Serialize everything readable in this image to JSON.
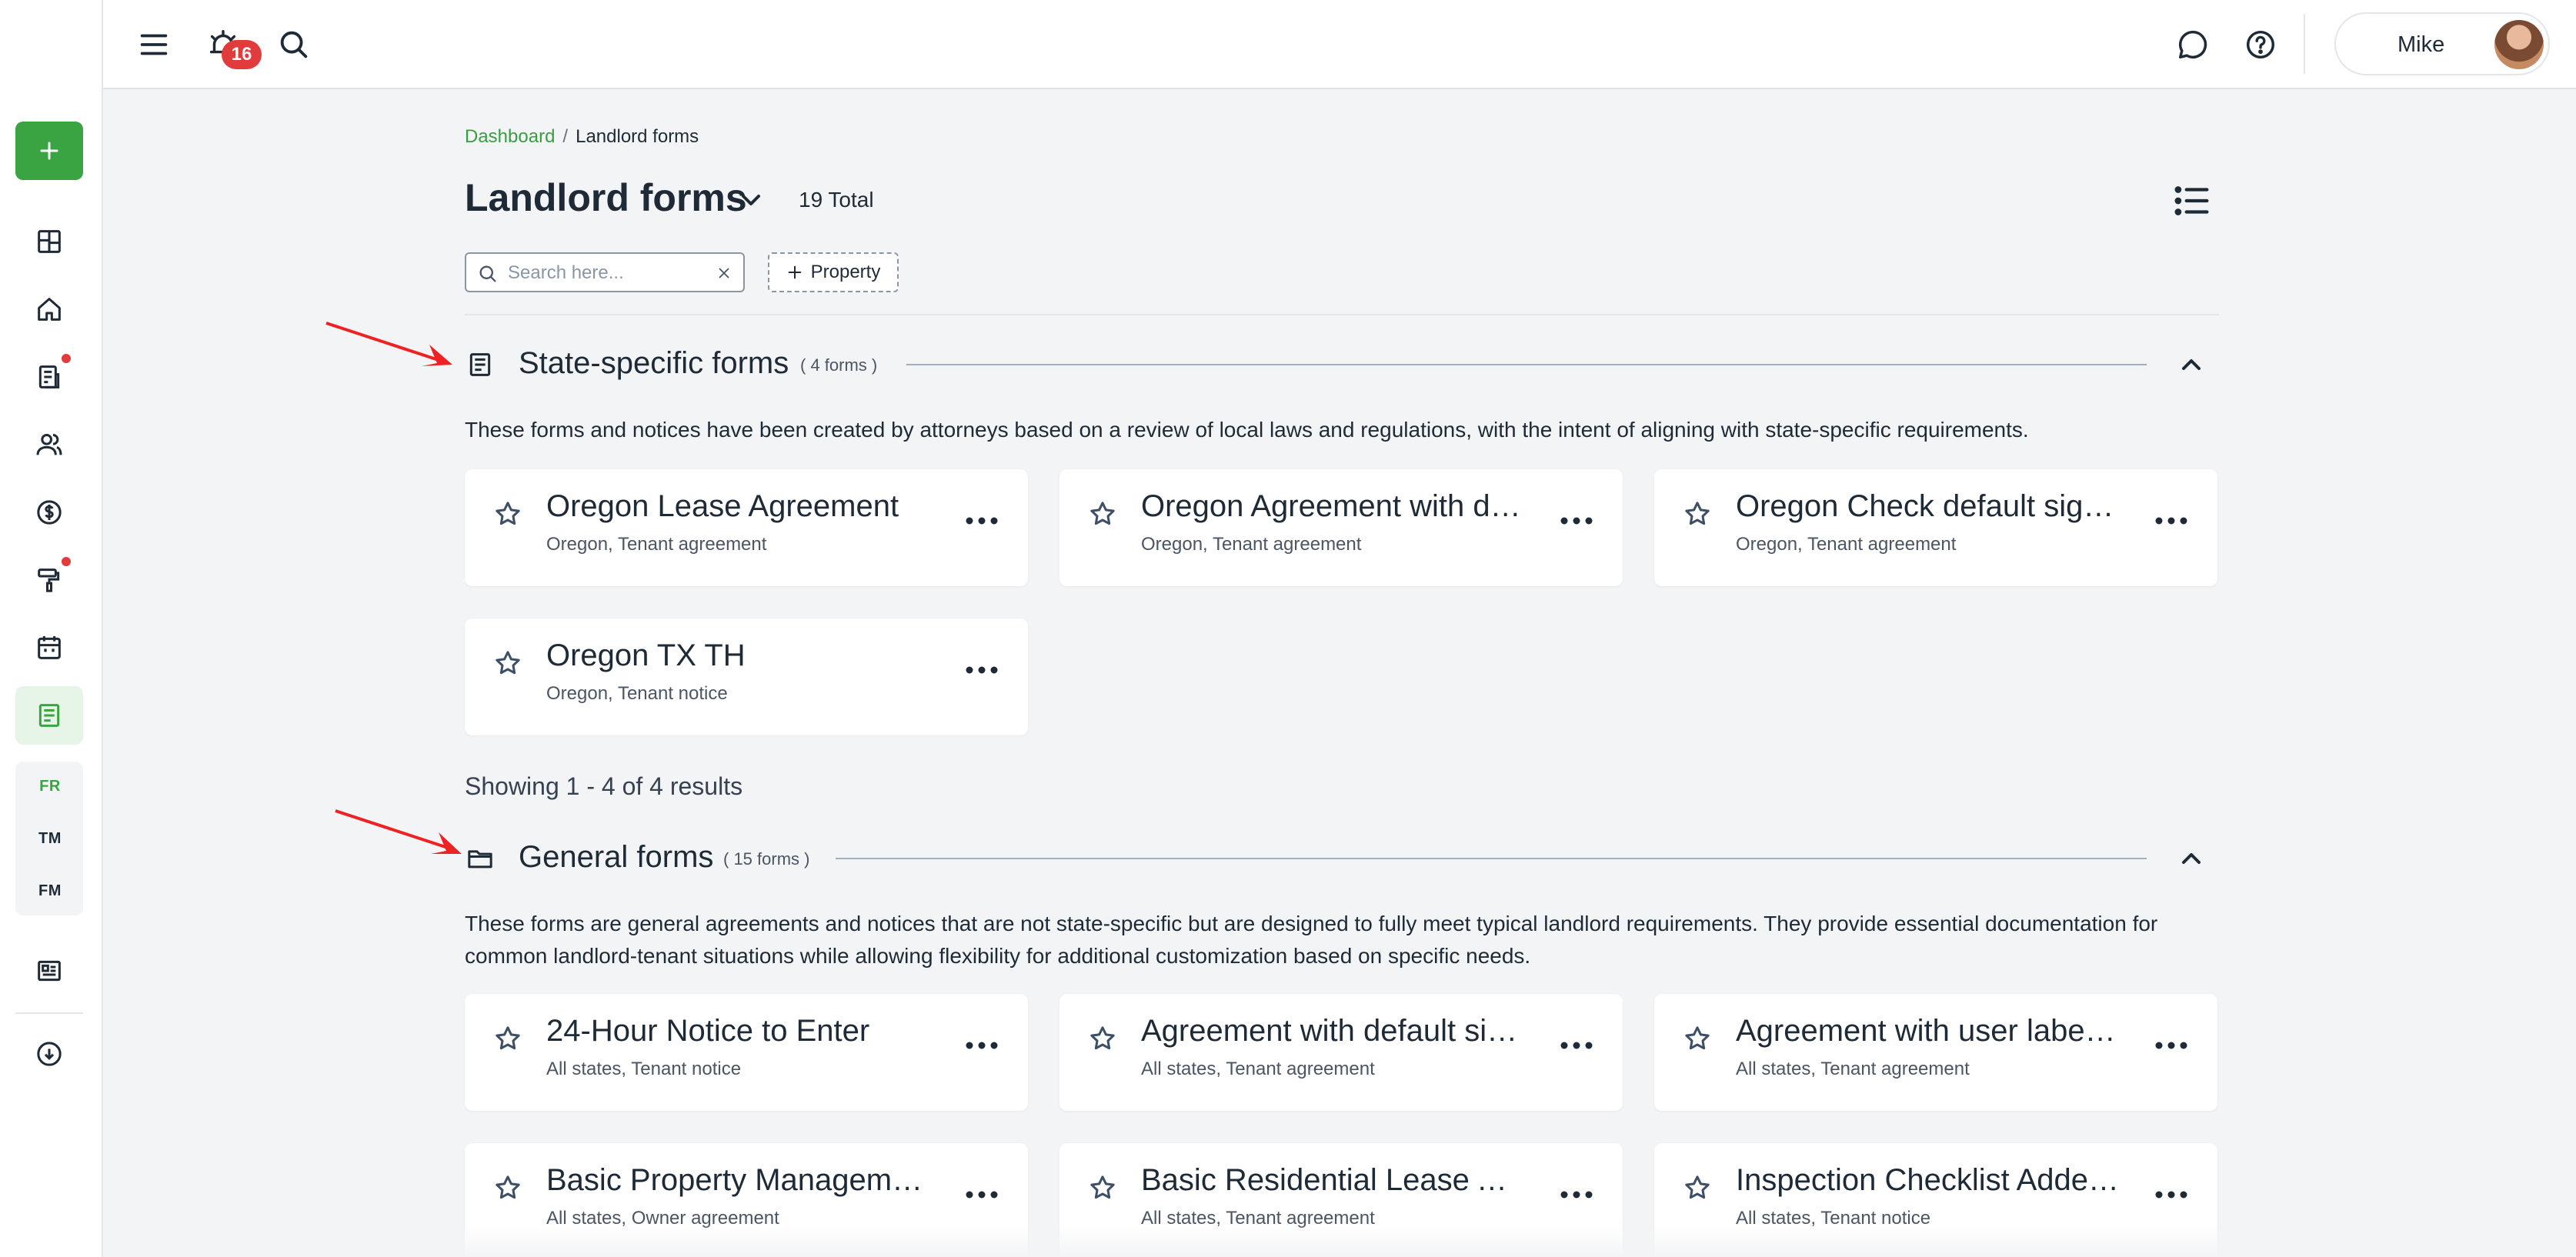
{
  "header": {
    "notification_count": "16",
    "user_name": "Mike"
  },
  "sidebar": {
    "shortcuts": [
      "FR",
      "TM",
      "FM"
    ]
  },
  "breadcrumb": {
    "root": "Dashboard",
    "separator": "/",
    "current": "Landlord forms"
  },
  "page": {
    "title": "Landlord forms",
    "total": "19 Total"
  },
  "filters": {
    "search_placeholder": "Search here...",
    "property_label": "Property"
  },
  "sections": [
    {
      "title": "State-specific forms",
      "count": "( 4 forms )",
      "description": "These forms and notices have been created by attorneys based on a review of local laws and regulations, with the intent of aligning with state-specific requirements.",
      "cards": [
        {
          "title": "Oregon Lease Agreement",
          "subtitle": "Oregon, Tenant agreement"
        },
        {
          "title": "Oregon Agreement with default signatures",
          "subtitle": "Oregon, Tenant agreement"
        },
        {
          "title": "Oregon Check default signatures",
          "subtitle": "Oregon, Tenant agreement"
        },
        {
          "title": "Oregon TX TH",
          "subtitle": "Oregon, Tenant notice"
        }
      ],
      "showing": "Showing 1 - 4 of 4 results"
    },
    {
      "title": "General forms",
      "count": "( 15 forms )",
      "description": "These forms are general agreements and notices that are not state-specific but are designed to fully meet typical landlord requirements. They provide essential documentation for common landlord-tenant situations while allowing flexibility for additional customization based on specific needs.",
      "cards": [
        {
          "title": "24-Hour Notice to Enter",
          "subtitle": "All states, Tenant notice"
        },
        {
          "title": "Agreement with default signatures",
          "subtitle": "All states, Tenant agreement"
        },
        {
          "title": "Agreement with user labels and signatures",
          "subtitle": "All states, Tenant agreement"
        },
        {
          "title": "Basic Property Management Agreement",
          "subtitle": "All states, Owner agreement"
        },
        {
          "title": "Basic Residential Lease Agreement",
          "subtitle": "All states, Tenant agreement"
        },
        {
          "title": "Inspection Checklist Addendum",
          "subtitle": "All states, Tenant notice"
        }
      ]
    }
  ],
  "colors": {
    "brand_green": "#3aa342",
    "badge_red": "#e23b3b",
    "annotation_arrow": "#ee2222"
  }
}
